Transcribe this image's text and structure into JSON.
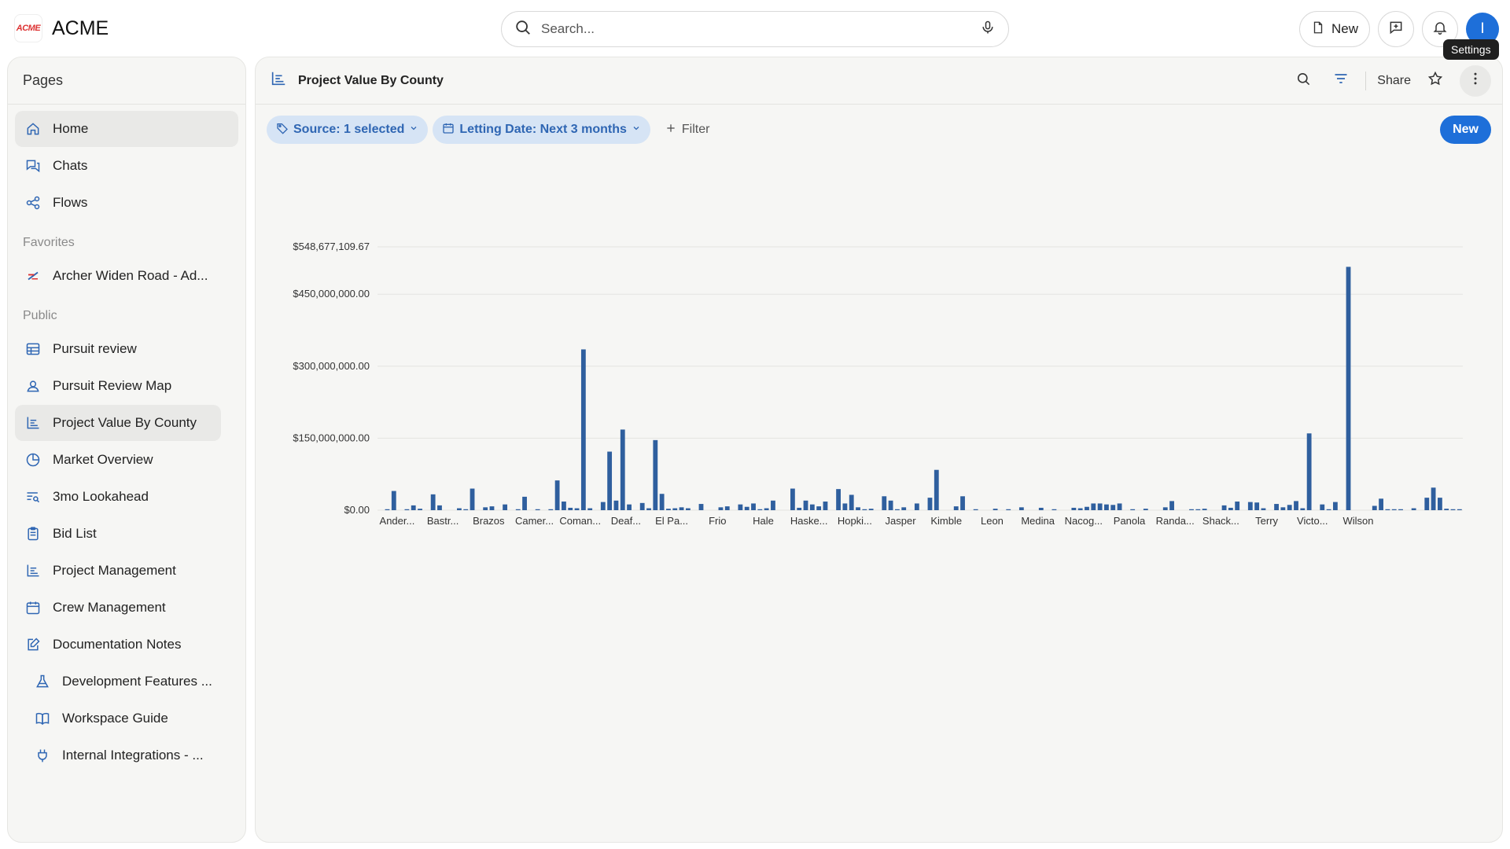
{
  "app": {
    "logo_text": "ACME",
    "name": "ACME"
  },
  "search": {
    "placeholder": "Search..."
  },
  "topbar": {
    "new_label": "New",
    "avatar_initial": "I",
    "tooltip": "Settings"
  },
  "sidebar": {
    "title": "Pages",
    "main_items": [
      {
        "label": "Home",
        "icon": "home-icon"
      },
      {
        "label": "Chats",
        "icon": "chat-icon"
      },
      {
        "label": "Flows",
        "icon": "flow-icon"
      }
    ],
    "favorites_title": "Favorites",
    "favorites": [
      {
        "label": "Archer Widen Road - Ad...",
        "icon": "flag-icon"
      }
    ],
    "public_title": "Public",
    "public_items": [
      {
        "label": "Pursuit review",
        "icon": "table-icon"
      },
      {
        "label": "Pursuit Review Map",
        "icon": "map-user-icon"
      },
      {
        "label": "Project Value By County",
        "icon": "bar-chart-icon"
      },
      {
        "label": "Market Overview",
        "icon": "pie-chart-icon"
      },
      {
        "label": "3mo Lookahead",
        "icon": "list-search-icon"
      },
      {
        "label": "Bid List",
        "icon": "clipboard-icon"
      },
      {
        "label": "Project Management",
        "icon": "bar-chart-icon"
      },
      {
        "label": "Crew Management",
        "icon": "calendar-icon"
      },
      {
        "label": "Documentation Notes",
        "icon": "edit-note-icon"
      },
      {
        "label": "Development Features ...",
        "icon": "flask-icon"
      },
      {
        "label": "Workspace Guide",
        "icon": "book-icon"
      },
      {
        "label": "Internal Integrations - ...",
        "icon": "plug-icon"
      }
    ]
  },
  "main": {
    "title": "Project Value By County",
    "share_label": "Share",
    "filters": {
      "source_label": "Source: 1 selected",
      "date_label": "Letting Date: Next 3 months",
      "add_filter_label": "Filter",
      "new_label": "New"
    }
  },
  "colors": {
    "accent": "#1e6fd9",
    "bar": "#2f5f9e",
    "chip_bg": "#d6e4f5",
    "chip_text": "#2f66b3"
  },
  "chart_data": {
    "type": "bar",
    "title": "",
    "xlabel": "",
    "ylabel": "",
    "ylim": [
      0,
      548677109.67
    ],
    "y_ticks": [
      {
        "value": 0,
        "label": "$0.00"
      },
      {
        "value": 150000000,
        "label": "$150,000,000.00"
      },
      {
        "value": 300000000,
        "label": "$300,000,000.00"
      },
      {
        "value": 450000000,
        "label": "$450,000,000.00"
      },
      {
        "value": 548677109.67,
        "label": "$548,677,109.67"
      }
    ],
    "x_tick_labels": [
      "Ander...",
      "Bastr...",
      "Brazos",
      "Camer...",
      "Coman...",
      "Deaf...",
      "El Pa...",
      "Frio",
      "Hale",
      "Haske...",
      "Hopki...",
      "Jasper",
      "Kimble",
      "Leon",
      "Medina",
      "Nacog...",
      "Panola",
      "Randa...",
      "Shack...",
      "Terry",
      "Victo...",
      "Wilson"
    ],
    "tick_every": 7,
    "values": [
      0,
      2000000,
      40000000,
      0,
      2000000,
      10000000,
      3000000,
      0,
      33000000,
      10000000,
      0,
      0,
      4000000,
      2000000,
      45000000,
      0,
      6000000,
      8000000,
      0,
      12000000,
      0,
      2000000,
      28000000,
      0,
      2000000,
      0,
      2000000,
      62000000,
      18000000,
      5000000,
      4000000,
      335000000,
      4000000,
      0,
      17000000,
      122000000,
      20000000,
      168000000,
      12000000,
      0,
      15000000,
      4000000,
      146000000,
      34000000,
      3000000,
      4000000,
      6000000,
      4000000,
      0,
      13000000,
      0,
      0,
      6000000,
      8000000,
      0,
      12000000,
      7000000,
      14000000,
      2000000,
      4000000,
      20000000,
      0,
      0,
      45000000,
      5000000,
      20000000,
      12000000,
      8000000,
      18000000,
      0,
      44000000,
      14000000,
      32000000,
      6000000,
      2000000,
      3000000,
      0,
      29000000,
      20000000,
      2000000,
      6000000,
      0,
      14000000,
      0,
      26000000,
      84000000,
      0,
      0,
      8000000,
      29000000,
      0,
      2000000,
      0,
      0,
      3000000,
      0,
      2000000,
      0,
      6000000,
      0,
      0,
      5000000,
      0,
      2000000,
      0,
      0,
      5000000,
      4000000,
      7000000,
      14000000,
      14000000,
      12000000,
      11000000,
      14000000,
      0,
      2000000,
      0,
      3000000,
      0,
      0,
      6000000,
      19000000,
      0,
      0,
      2000000,
      2000000,
      3000000,
      0,
      0,
      10000000,
      5000000,
      18000000,
      0,
      17000000,
      16000000,
      4000000,
      0,
      13000000,
      6000000,
      11000000,
      19000000,
      4000000,
      160000000,
      0,
      12000000,
      2000000,
      17000000,
      0,
      507000000,
      0,
      0,
      0,
      9000000,
      24000000,
      2000000,
      2000000,
      2000000,
      0,
      4000000,
      0,
      26000000,
      47000000,
      26000000,
      3000000,
      2000000,
      2000000
    ]
  }
}
